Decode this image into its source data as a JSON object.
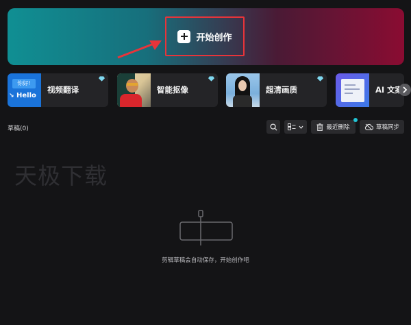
{
  "banner": {
    "start_label": "开始创作"
  },
  "tools": [
    {
      "label": "视频翻译",
      "thumb_text_1": "你好!",
      "thumb_text_2": "Hello"
    },
    {
      "label": "智能抠像"
    },
    {
      "label": "超清画质"
    },
    {
      "label": "AI 文案"
    }
  ],
  "drafts": {
    "title": "草稿(0)",
    "recent_delete_label": "最近删除",
    "sync_label": "草稿同步"
  },
  "watermark": "天极下载",
  "empty_state": {
    "message": "剪辑草稿会自动保存，开始创作吧"
  },
  "colors": {
    "accent_red": "#e8343a",
    "diamond": "#7fd8f0",
    "badge": "#22c4d4"
  }
}
